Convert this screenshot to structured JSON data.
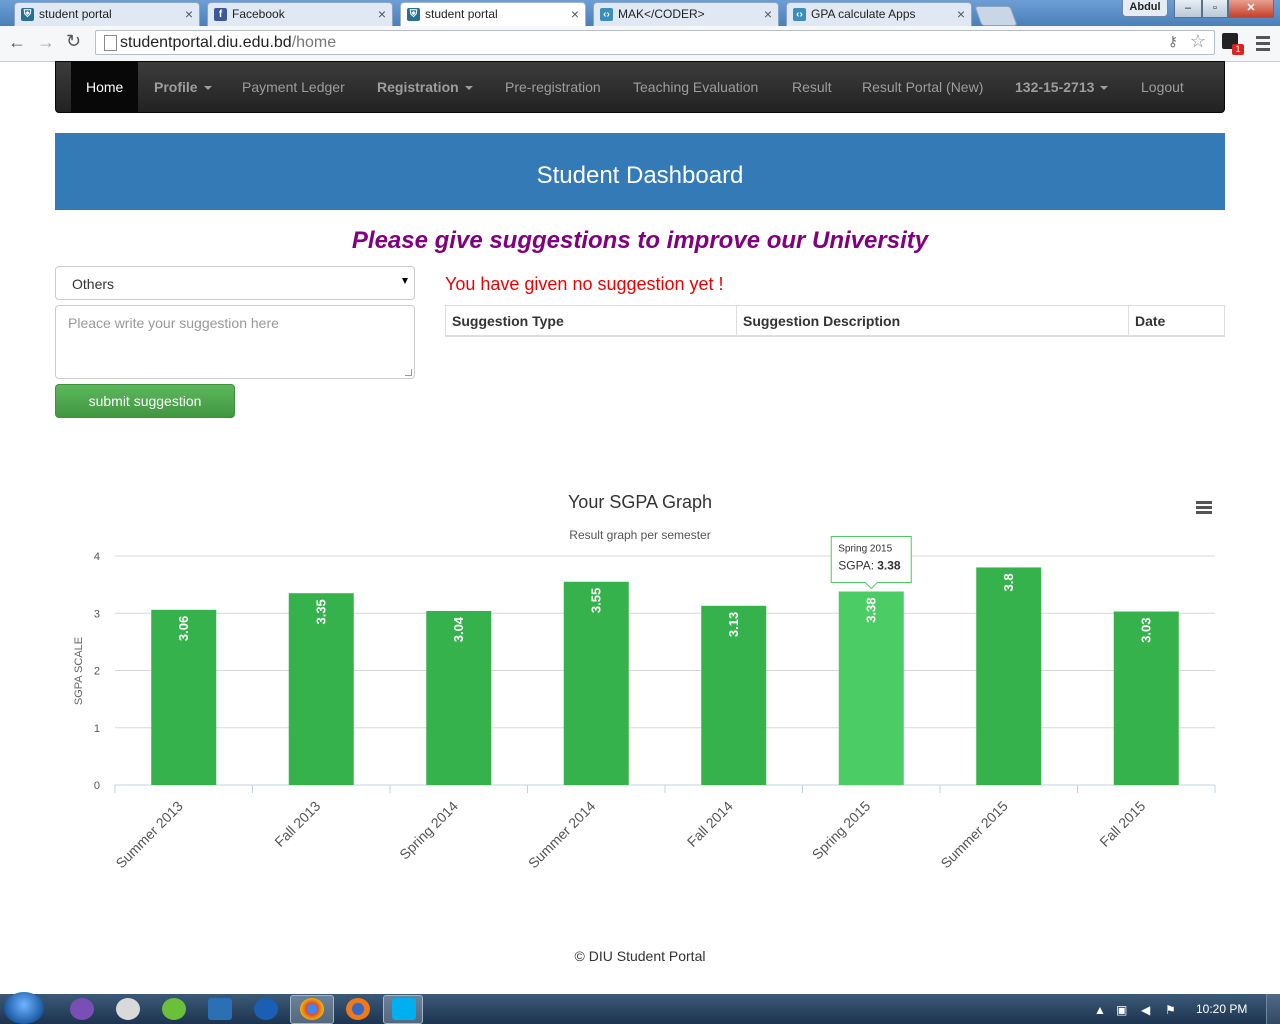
{
  "browser": {
    "tabs": [
      {
        "title": "student portal",
        "icon": "shield-icon",
        "active": false
      },
      {
        "title": "Facebook",
        "icon": "facebook-icon",
        "active": false
      },
      {
        "title": "student portal",
        "icon": "shield-icon",
        "active": true
      },
      {
        "title": "MAK</CODER>",
        "icon": "code-icon",
        "active": false
      },
      {
        "title": "GPA calculate Apps",
        "icon": "code-icon",
        "active": false
      }
    ],
    "user": "Abdul",
    "url_host": "studentportal.diu.edu.bd",
    "url_path": "/home",
    "extension_badge": "1"
  },
  "navbar": {
    "items": [
      "Home",
      "Profile",
      "Payment Ledger",
      "Registration",
      "Pre-registration",
      "Teaching Evaluation",
      "Result",
      "Result Portal (New)",
      "132-15-2713",
      "Logout"
    ]
  },
  "banner": {
    "title": "Student Dashboard"
  },
  "suggestion": {
    "appeal": "Please give suggestions to improve our University",
    "type_selected": "Others",
    "placeholder": "Pleace write your suggestion here",
    "submit_label": "submit suggestion",
    "empty_message": "You have given no suggestion yet !",
    "table_headers": [
      "Suggestion Type",
      "Suggestion Description",
      "Date"
    ]
  },
  "chart_data": {
    "type": "bar",
    "title": "Your SGPA Graph",
    "subtitle": "Result graph per semester",
    "ylabel": "SGPA SCALE",
    "xlabel": "",
    "categories": [
      "Summer 2013",
      "Fall 2013",
      "Spring 2014",
      "Summer 2014",
      "Fall 2014",
      "Spring 2015",
      "Summer 2015",
      "Fall 2015"
    ],
    "values": [
      3.06,
      3.35,
      3.04,
      3.55,
      3.13,
      3.38,
      3.8,
      3.03
    ],
    "ylim": [
      0,
      4
    ],
    "yticks": [
      0,
      1,
      2,
      3,
      4
    ],
    "grid": true,
    "bar_color": "#35b24b",
    "highlight_color": "#4ccc64",
    "tooltip": {
      "category": "Spring 2015",
      "label": "SGPA:",
      "value": "3.38"
    }
  },
  "footer": {
    "text": "© DIU Student Portal"
  },
  "taskbar": {
    "time": "10:20 PM"
  }
}
